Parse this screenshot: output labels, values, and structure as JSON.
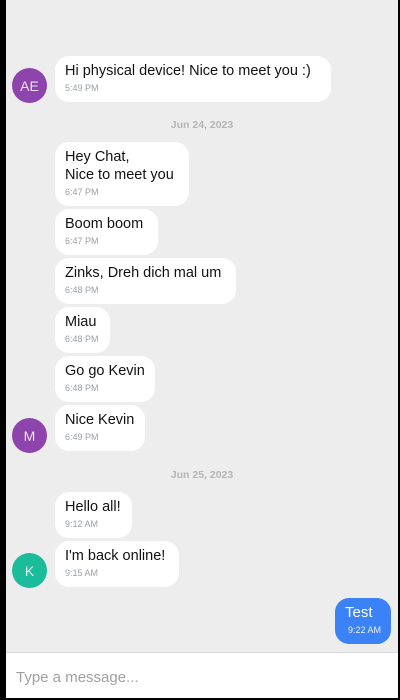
{
  "conversation": {
    "messages": [
      {
        "text": "Hi physical device! Nice to meet you :)",
        "time": "5:49 PM",
        "avatar": "AE",
        "avatar_color": "#8e44ad"
      },
      {
        "date": "Jun 24, 2023"
      },
      {
        "text": "Hey Chat,\nNice to meet you",
        "time": "6:47 PM"
      },
      {
        "text": "Boom boom",
        "time": "6:47 PM"
      },
      {
        "text": "Zinks, Dreh dich mal um",
        "time": "6:48 PM"
      },
      {
        "text": "Miau",
        "time": "6:48 PM"
      },
      {
        "text": "Go go Kevin",
        "time": "6:48 PM"
      },
      {
        "text": "Nice Kevin",
        "time": "6:49 PM",
        "avatar": "M",
        "avatar_color": "#8e44ad"
      },
      {
        "date": "Jun 25, 2023"
      },
      {
        "text": "Hello all!",
        "time": "9:12 AM"
      },
      {
        "text": "I'm back online!",
        "time": "9:15 AM",
        "avatar": "K",
        "avatar_color": "#1abc9c"
      },
      {
        "text": "Test",
        "time": "9:22 AM",
        "outgoing": true,
        "bubble_color": "#3b82f6"
      }
    ]
  },
  "composer": {
    "placeholder": "Type a message..."
  }
}
